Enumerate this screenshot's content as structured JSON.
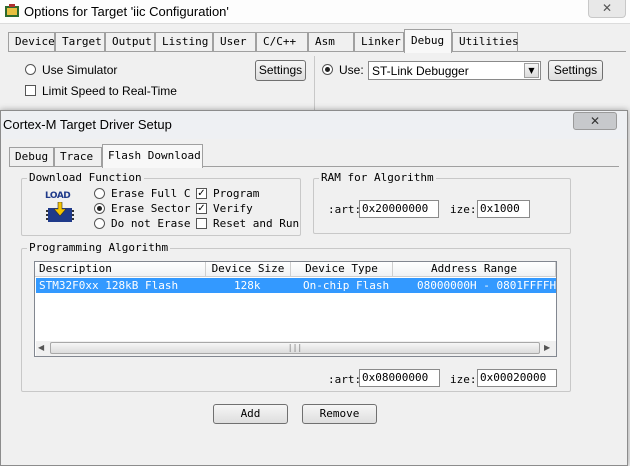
{
  "outer": {
    "title": "Options for Target 'iic Configuration'",
    "close_glyph": "✕",
    "tabs": [
      "Device",
      "Target",
      "Output",
      "Listing",
      "User",
      "C/C++",
      "Asm",
      "Linker",
      "Debug",
      "Utilities"
    ],
    "active_tab": "Debug",
    "use_simulator_label": "Use Simulator",
    "limit_speed_label": "Limit Speed to Real-Time",
    "settings_left_label": "Settings",
    "use_label": "Use:",
    "debugger_value": "ST-Link Debugger",
    "settings_right_label": "Settings"
  },
  "inner": {
    "title": "Cortex-M Target Driver Setup",
    "close_glyph": "✕",
    "tabs": [
      "Debug",
      "Trace",
      "Flash Download"
    ],
    "active_tab": "Flash Download",
    "download_function": {
      "title": "Download Function",
      "load_icon_text": "LOAD",
      "erase_full_label": "Erase Full C",
      "erase_sector_label": "Erase Sector",
      "do_not_erase_label": "Do not Erase",
      "program_label": "Program",
      "verify_label": "Verify",
      "reset_run_label": "Reset and Run"
    },
    "ram": {
      "title": "RAM for Algorithm",
      "start_label": ":art:",
      "start_value": "0x20000000",
      "size_label": "ize:",
      "size_value": "0x1000"
    },
    "programming_algorithm": {
      "title": "Programming Algorithm",
      "columns": [
        "Description",
        "Device Size",
        "Device Type",
        "Address Range"
      ],
      "rows": [
        {
          "description": "STM32F0xx 128kB Flash",
          "size": "128k",
          "type": "On-chip Flash",
          "range": "08000000H - 0801FFFFH"
        }
      ],
      "start_label": ":art:",
      "start_value": "0x08000000",
      "size_label": "ize:",
      "size_value": "0x00020000"
    },
    "add_label": "Add",
    "remove_label": "Remove"
  },
  "colors": {
    "selection": "#3399ff",
    "load_icon": "#1f3a8a"
  }
}
